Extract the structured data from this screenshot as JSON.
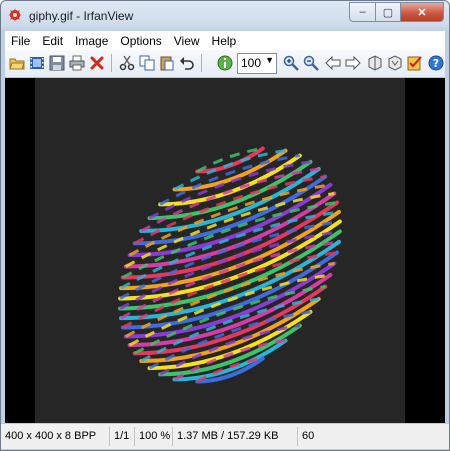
{
  "window": {
    "title": "giphy.gif - IrfanView"
  },
  "caption_buttons": {
    "minimize": "–",
    "maximize": "▢",
    "close": "✕"
  },
  "menu": [
    "File",
    "Edit",
    "Image",
    "Options",
    "View",
    "Help"
  ],
  "toolbar": {
    "zoom_value": "100",
    "icons": [
      "open-folder-icon",
      "film-strip-icon",
      "save-icon",
      "print-icon",
      "delete-icon",
      "cut-icon",
      "copy-icon",
      "paste-icon",
      "undo-icon",
      "info-icon",
      "zoom-in-icon",
      "zoom-out-icon",
      "previous-icon",
      "next-icon",
      "first-icon",
      "last-icon",
      "checklist-icon",
      "help-icon"
    ]
  },
  "image": {
    "description_colors": [
      "#e8365d",
      "#f2a21b",
      "#f6e21a",
      "#3bc46a",
      "#27b6d8",
      "#3d6be0",
      "#8a3ad6",
      "#d93aa5"
    ]
  },
  "status": {
    "dimensions": "400 x 400 x 8 BPP",
    "page": "1/1",
    "zoom": "100 %",
    "size": "1.37 MB / 157.29 KB",
    "frame_delay": "60"
  }
}
